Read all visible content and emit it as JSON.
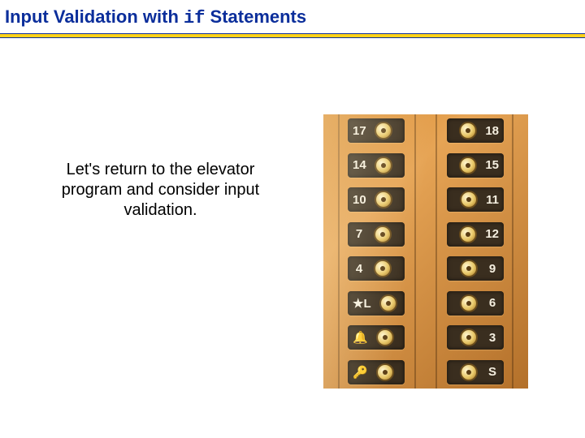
{
  "title": {
    "pre": "Input Validation with ",
    "code": "if",
    "post": " Statements"
  },
  "body": "Let's return to the elevator program and consider input validation.",
  "elevator": {
    "left": [
      "17",
      "14",
      "10",
      "7",
      "4",
      "★L",
      "🔔",
      "🔑"
    ],
    "right": [
      "18",
      "15",
      "11",
      "12",
      "9",
      "6",
      "3",
      "S"
    ]
  }
}
